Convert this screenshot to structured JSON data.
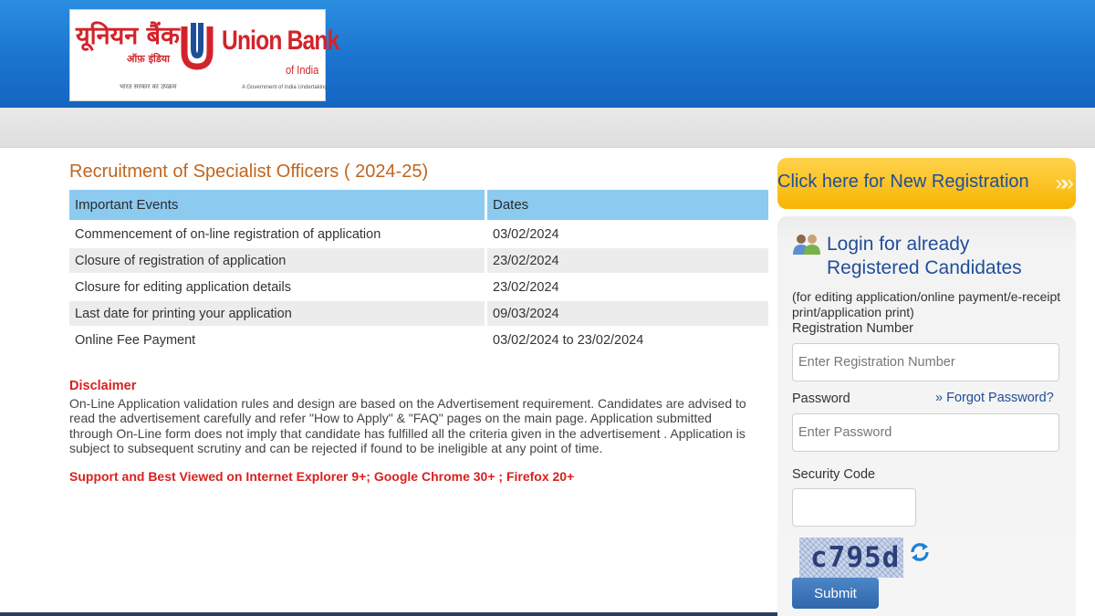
{
  "colors": {
    "header_blue": "#1a74cf",
    "title_orange": "#c0651e",
    "table_header_blue": "#8ccaf0",
    "alert_red": "#d9211f",
    "link_blue": "#1f4e99",
    "cta_yellow": "#f7b500",
    "submit_blue": "#2f67ab"
  },
  "logo": {
    "hindi_name": "यूनियन बैंक",
    "hindi_sub": "ऑफ़ इंडिया",
    "hindi_tagline": "भारत सरकार का उपक्रम",
    "english_name": "Union Bank",
    "english_sub": "of India",
    "english_tagline": "A Government of India Undertaking"
  },
  "page": {
    "title": "Recruitment of Specialist Officers ( 2024-25)"
  },
  "events": {
    "headers": [
      "Important Events",
      "Dates"
    ],
    "rows": [
      {
        "event": "Commencement of on-line registration of application",
        "date": "03/02/2024"
      },
      {
        "event": "Closure of registration of application",
        "date": "23/02/2024"
      },
      {
        "event": "Closure for editing application details",
        "date": "23/02/2024"
      },
      {
        "event": "Last date for printing your application",
        "date": "09/03/2024"
      },
      {
        "event": "Online Fee Payment",
        "date": "03/02/2024 to 23/02/2024"
      }
    ]
  },
  "disclaimer": {
    "title": "Disclaimer",
    "text": "On-Line Application validation rules and design are based on the Advertisement requirement. Candidates are advised to read the advertisement carefully and refer \"How to Apply\" & \"FAQ\" pages on the main page. Application submitted through On-Line form does not imply that candidate has fulfilled all the criteria given in the advertisement . Application is subject to subsequent scrutiny and can be rejected if found to be ineligible at any point of time.",
    "support": "Support and Best Viewed on Internet Explorer 9+; Google Chrome 30+ ; Firefox 20+"
  },
  "new_registration": {
    "label": "Click here for New Registration",
    "chevron": "»",
    "icon": "double-chevron-right-icon"
  },
  "login": {
    "icon": "users-icon",
    "title": "Login for already Registered Candidates",
    "note": "(for editing application/online payment/e-receipt print/application print)",
    "registration_label": "Registration Number",
    "registration_placeholder": "Enter Registration Number",
    "password_label": "Password",
    "forgot_label": "» Forgot Password?",
    "password_placeholder": "Enter Password",
    "security_label": "Security Code",
    "captcha_text": "c795d",
    "refresh_icon": "refresh-icon",
    "submit_label": "Submit"
  }
}
